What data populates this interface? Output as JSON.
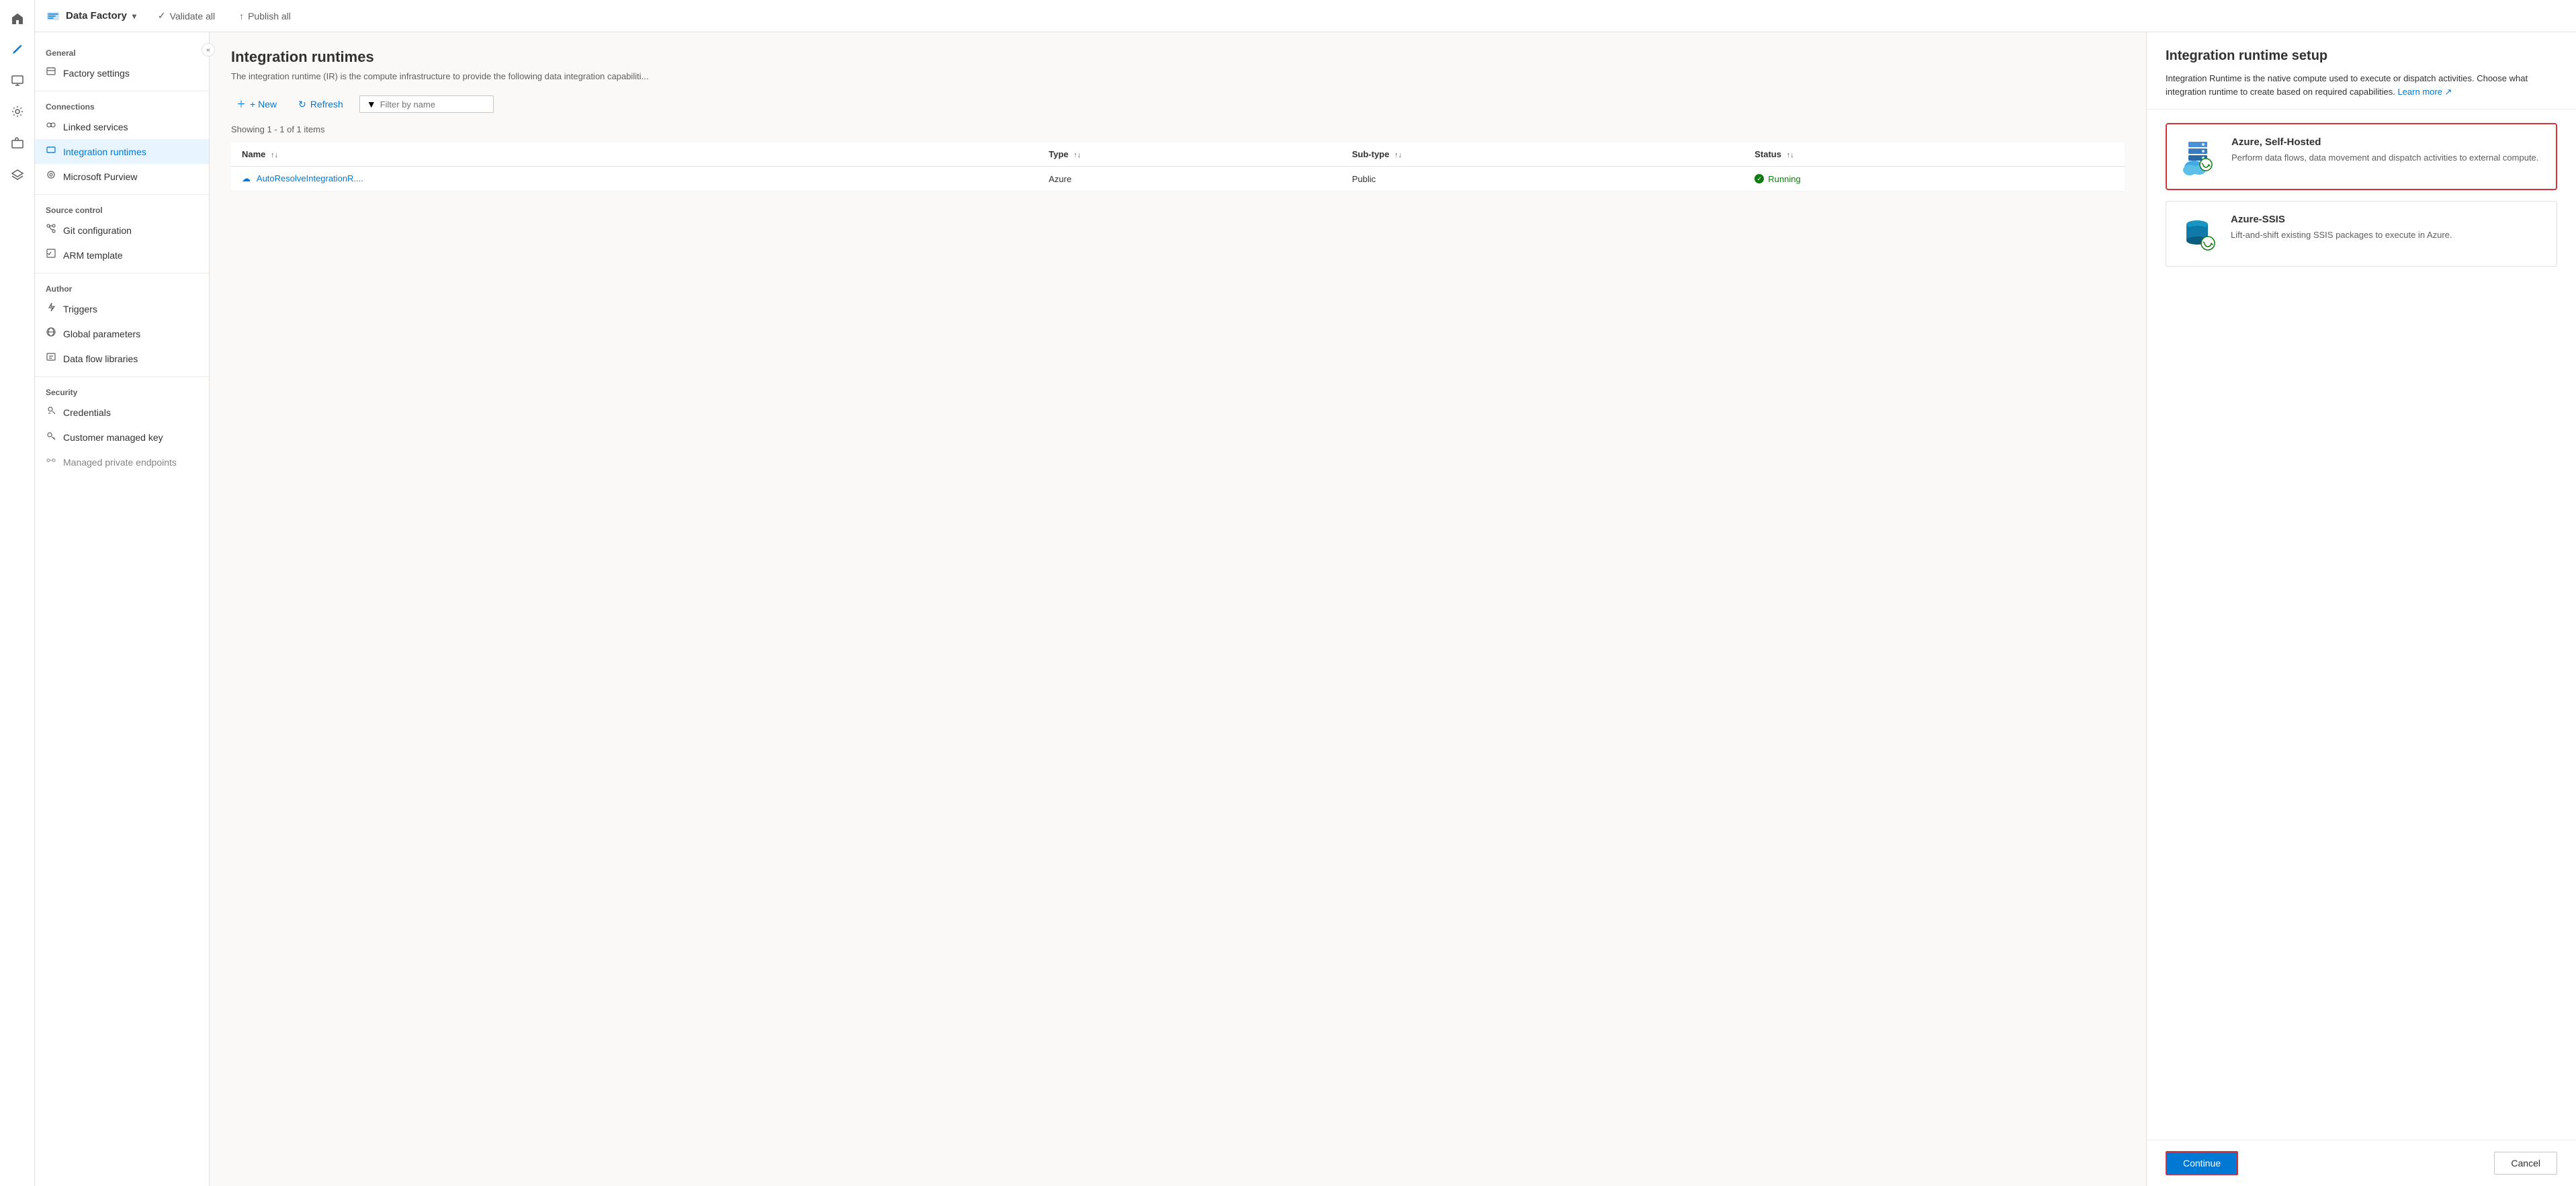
{
  "app": {
    "brand_label": "Data Factory",
    "brand_icon": "chart-icon",
    "chevron": "▾",
    "collapse_icon": "«"
  },
  "topbar": {
    "validate_all_label": "Validate all",
    "publish_all_label": "Publish all",
    "validate_icon": "✓",
    "publish_icon": "↑"
  },
  "sidebar": {
    "general_label": "General",
    "connections_label": "Connections",
    "source_control_label": "Source control",
    "author_label": "Author",
    "security_label": "Security",
    "items": {
      "factory_settings": "Factory settings",
      "linked_services": "Linked services",
      "integration_runtimes": "Integration runtimes",
      "microsoft_purview": "Microsoft Purview",
      "git_configuration": "Git configuration",
      "arm_template": "ARM template",
      "triggers": "Triggers",
      "global_parameters": "Global parameters",
      "data_flow_libraries": "Data flow libraries",
      "credentials": "Credentials",
      "customer_managed_key": "Customer managed key",
      "managed_private_endpoints": "Managed private endpoints"
    }
  },
  "main": {
    "title": "Integration runtimes",
    "subtitle": "The integration runtime (IR) is the compute infrastructure to provide the following data integration capabiliti...",
    "new_label": "+ New",
    "refresh_label": "Refresh",
    "filter_placeholder": "Filter by name",
    "showing_text": "Showing 1 - 1 of 1 items",
    "table": {
      "headers": [
        "Name",
        "Type",
        "Sub-type",
        "Status"
      ],
      "rows": [
        {
          "name": "AutoResolveIntegrationR....",
          "type": "Azure",
          "subtype": "Public",
          "status": "Running"
        }
      ]
    }
  },
  "right_panel": {
    "title": "Integration runtime setup",
    "description": "Integration Runtime is the native compute used to execute or dispatch activities. Choose what integration runtime to create based on required capabilities.",
    "learn_more_label": "Learn more",
    "options": [
      {
        "id": "azure-self-hosted",
        "title": "Azure, Self-Hosted",
        "description": "Perform data flows, data movement and dispatch activities to external compute.",
        "selected": true
      },
      {
        "id": "azure-ssis",
        "title": "Azure-SSIS",
        "description": "Lift-and-shift existing SSIS packages to execute in Azure.",
        "selected": false
      }
    ],
    "continue_label": "Continue",
    "cancel_label": "Cancel"
  },
  "colors": {
    "accent_blue": "#0078d4",
    "accent_red": "#d13438",
    "success_green": "#107c10",
    "text_primary": "#323130",
    "text_secondary": "#605e5c"
  }
}
